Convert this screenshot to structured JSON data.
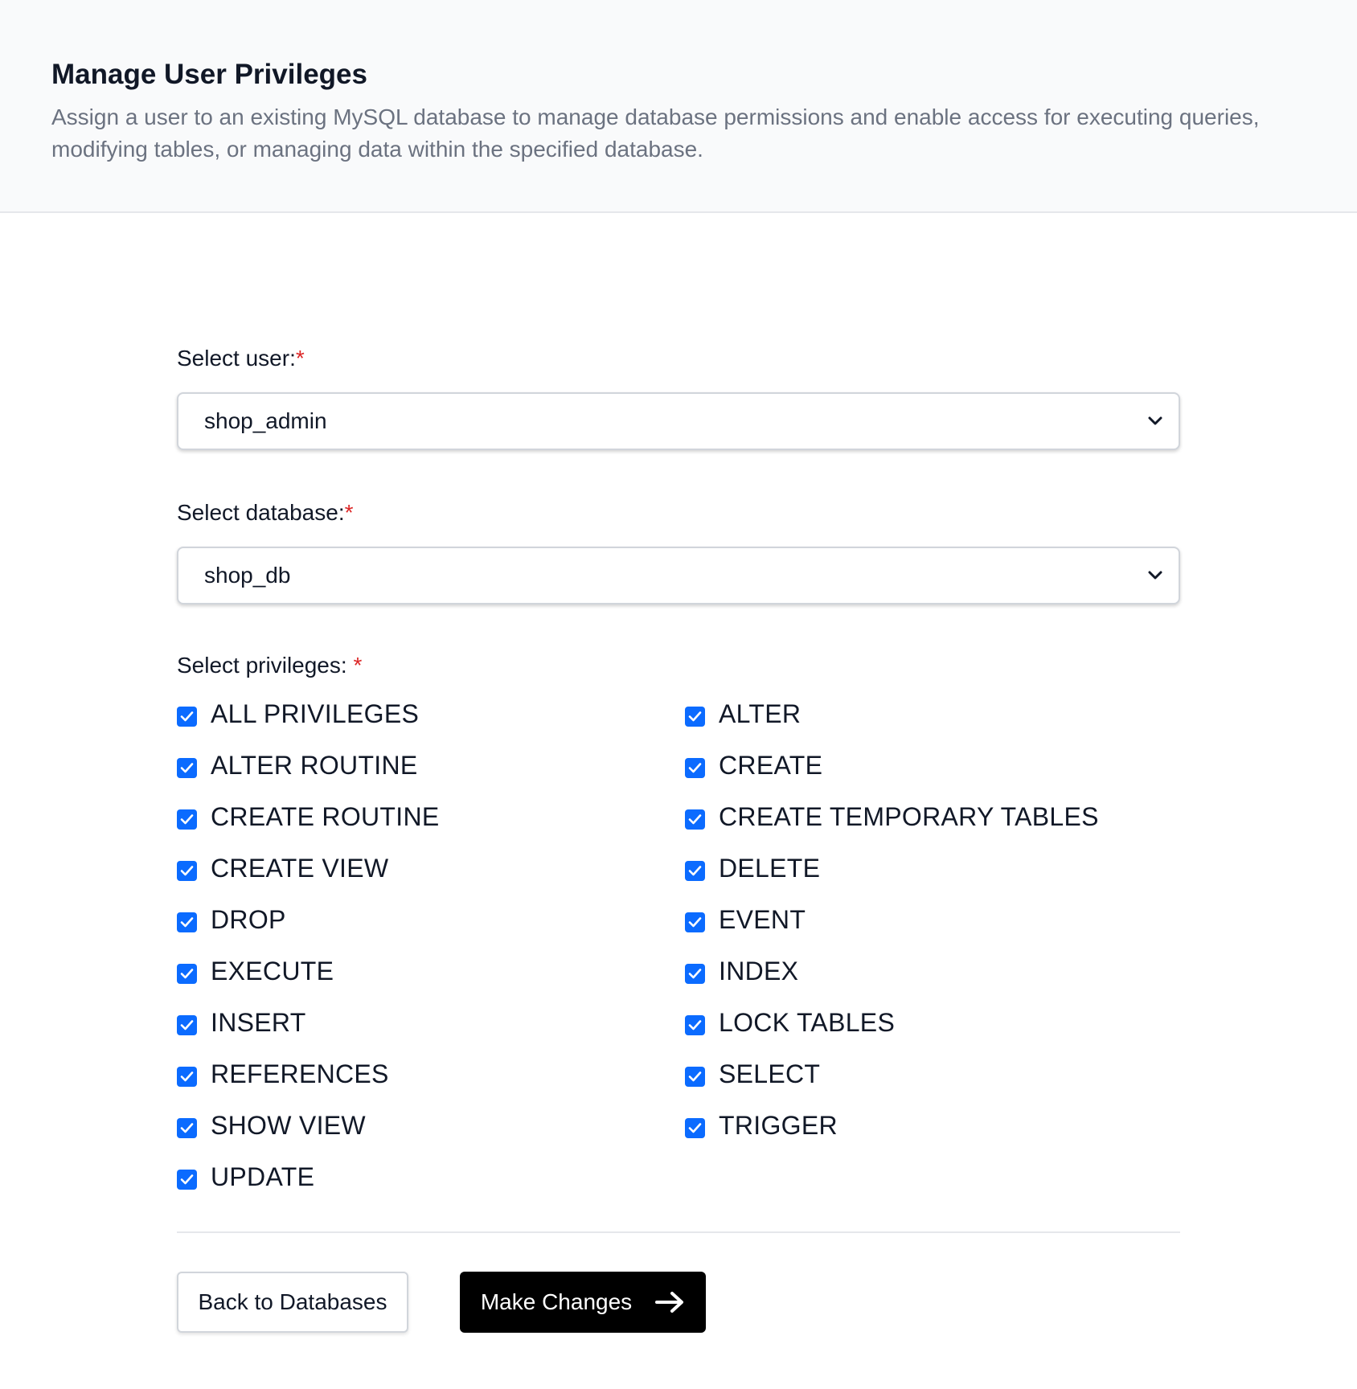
{
  "header": {
    "title": "Manage User Privileges",
    "description": "Assign a user to an existing MySQL database to manage database permissions and enable access for executing queries, modifying tables, or managing data within the specified database."
  },
  "form": {
    "user_label": "Select user:",
    "user_value": "shop_admin",
    "database_label": "Select database:",
    "database_value": "shop_db",
    "privileges_label": "Select privileges: ",
    "required_mark": "*",
    "privileges": [
      {
        "label": "ALL PRIVILEGES",
        "checked": true
      },
      {
        "label": "ALTER",
        "checked": true
      },
      {
        "label": "ALTER ROUTINE",
        "checked": true
      },
      {
        "label": "CREATE",
        "checked": true
      },
      {
        "label": "CREATE ROUTINE",
        "checked": true
      },
      {
        "label": "CREATE TEMPORARY TABLES",
        "checked": true
      },
      {
        "label": "CREATE VIEW",
        "checked": true
      },
      {
        "label": "DELETE",
        "checked": true
      },
      {
        "label": "DROP",
        "checked": true
      },
      {
        "label": "EVENT",
        "checked": true
      },
      {
        "label": "EXECUTE",
        "checked": true
      },
      {
        "label": "INDEX",
        "checked": true
      },
      {
        "label": "INSERT",
        "checked": true
      },
      {
        "label": "LOCK TABLES",
        "checked": true
      },
      {
        "label": "REFERENCES",
        "checked": true
      },
      {
        "label": "SELECT",
        "checked": true
      },
      {
        "label": "SHOW VIEW",
        "checked": true
      },
      {
        "label": "TRIGGER",
        "checked": true
      },
      {
        "label": "UPDATE",
        "checked": true
      }
    ]
  },
  "actions": {
    "back_label": "Back to Databases",
    "submit_label": "Make Changes"
  },
  "colors": {
    "checkbox": "#0b6bff",
    "required": "#dc2626",
    "primary_button": "#000000"
  }
}
